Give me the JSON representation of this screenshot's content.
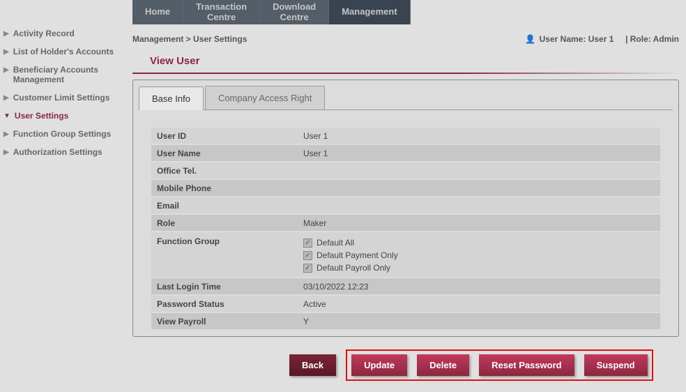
{
  "topnav": [
    {
      "label": "Home"
    },
    {
      "label": "Transaction\nCentre"
    },
    {
      "label": "Download\nCentre"
    },
    {
      "label": "Management"
    }
  ],
  "sidebar": [
    {
      "label": "Activity Record"
    },
    {
      "label": "List of Holder's Accounts"
    },
    {
      "label": "Beneficiary Accounts\nManagement"
    },
    {
      "label": "Customer Limit Settings"
    },
    {
      "label": "User Settings"
    },
    {
      "label": "Function Group Settings"
    },
    {
      "label": "Authorization Settings"
    }
  ],
  "breadcrumb": "Management > User Settings",
  "header": {
    "username_label": "User Name:",
    "username": "User 1",
    "role_label": "| Role:",
    "role": "Admin"
  },
  "page_title": "View User",
  "tabs": [
    {
      "label": "Base Info"
    },
    {
      "label": "Company Access Right"
    }
  ],
  "info": {
    "user_id": {
      "label": "User ID",
      "value": "User 1"
    },
    "user_name": {
      "label": "User Name",
      "value": "User 1"
    },
    "office_tel": {
      "label": "Office Tel.",
      "value": ""
    },
    "mobile_phone": {
      "label": "Mobile Phone",
      "value": ""
    },
    "email": {
      "label": "Email",
      "value": ""
    },
    "role": {
      "label": "Role",
      "value": "Maker"
    },
    "function_group": {
      "label": "Function Group",
      "items": [
        {
          "label": "Default All",
          "checked": true
        },
        {
          "label": "Default Payment Only",
          "checked": true
        },
        {
          "label": "Default Payroll Only",
          "checked": true
        }
      ]
    },
    "last_login": {
      "label": "Last Login Time",
      "value": "03/10/2022 12:23"
    },
    "password_status": {
      "label": "Password Status",
      "value": "Active"
    },
    "view_payroll": {
      "label": "View Payroll",
      "value": "Y"
    }
  },
  "buttons": {
    "back": "Back",
    "update": "Update",
    "delete": "Delete",
    "reset_password": "Reset Password",
    "suspend": "Suspend"
  }
}
